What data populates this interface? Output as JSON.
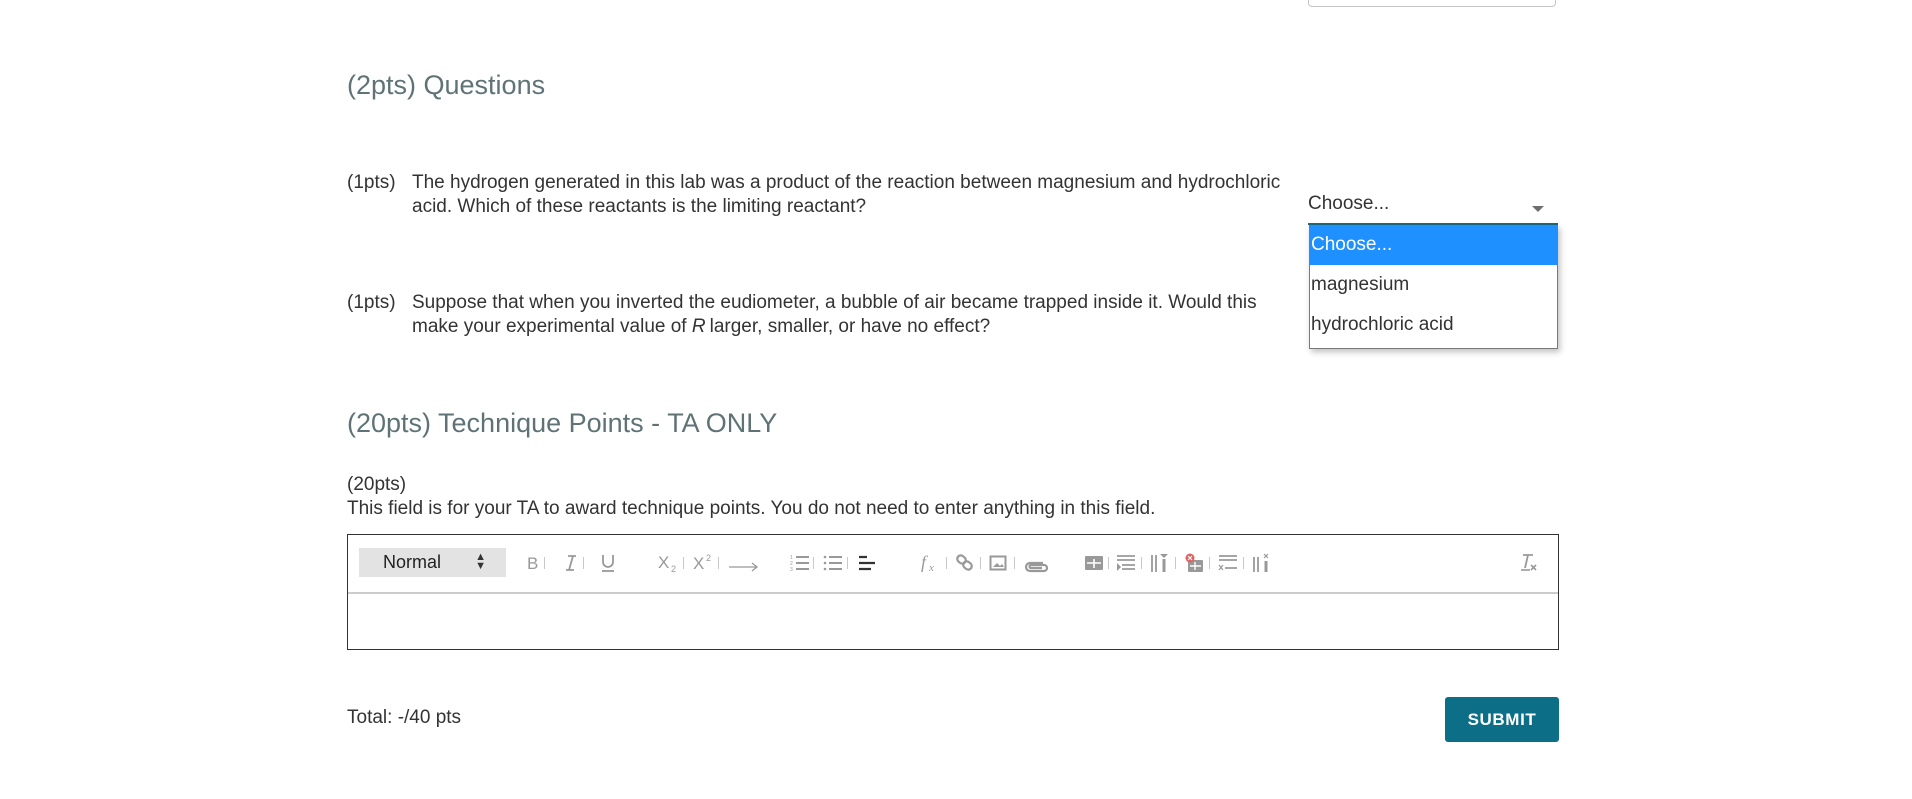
{
  "sections": {
    "questions": {
      "heading": "(2pts) Questions",
      "items": [
        {
          "points": "(1pts)",
          "text": "The hydrogen generated in this lab was a product of the reaction between magnesium and hydrochloric acid. Which of these reactants is the limiting reactant?",
          "answer_select": {
            "value": "Choose...",
            "open": true,
            "options": [
              "Choose...",
              "magnesium",
              "hydrochloric acid"
            ],
            "highlighted_option": "Choose..."
          }
        },
        {
          "points": "(1pts)",
          "text_before": "Suppose that when you inverted the eudiometer, a bubble of air became trapped inside it. Would this make your experimental value of",
          "variable": "R",
          "text_after": "larger, smaller, or have no effect?"
        }
      ]
    },
    "technique": {
      "heading": "(20pts) Technique Points - TA ONLY",
      "points": "(20pts)",
      "description": "This field is for your TA to award technique points. You do not need to enter anything in this field.",
      "editor": {
        "format_value": "Normal",
        "content": "",
        "toolbar_icons": [
          "bold-icon",
          "italic-icon",
          "underline-icon",
          "subscript-icon",
          "superscript-icon",
          "arrow-icon",
          "ordered-list-icon",
          "bullet-list-icon",
          "align-icon",
          "formula-icon",
          "link-icon",
          "image-icon",
          "attachment-icon",
          "table-icon",
          "insert-row-icon",
          "insert-column-icon",
          "delete-table-icon",
          "delete-row-icon",
          "delete-column-icon",
          "clear-format-icon"
        ]
      }
    }
  },
  "footer": {
    "total": "Total: -/40 pts",
    "submit_label": "SUBMIT"
  },
  "colors": {
    "heading": "#5f7377",
    "accent": "#0d6e87",
    "option_highlight": "#1e90ff"
  }
}
